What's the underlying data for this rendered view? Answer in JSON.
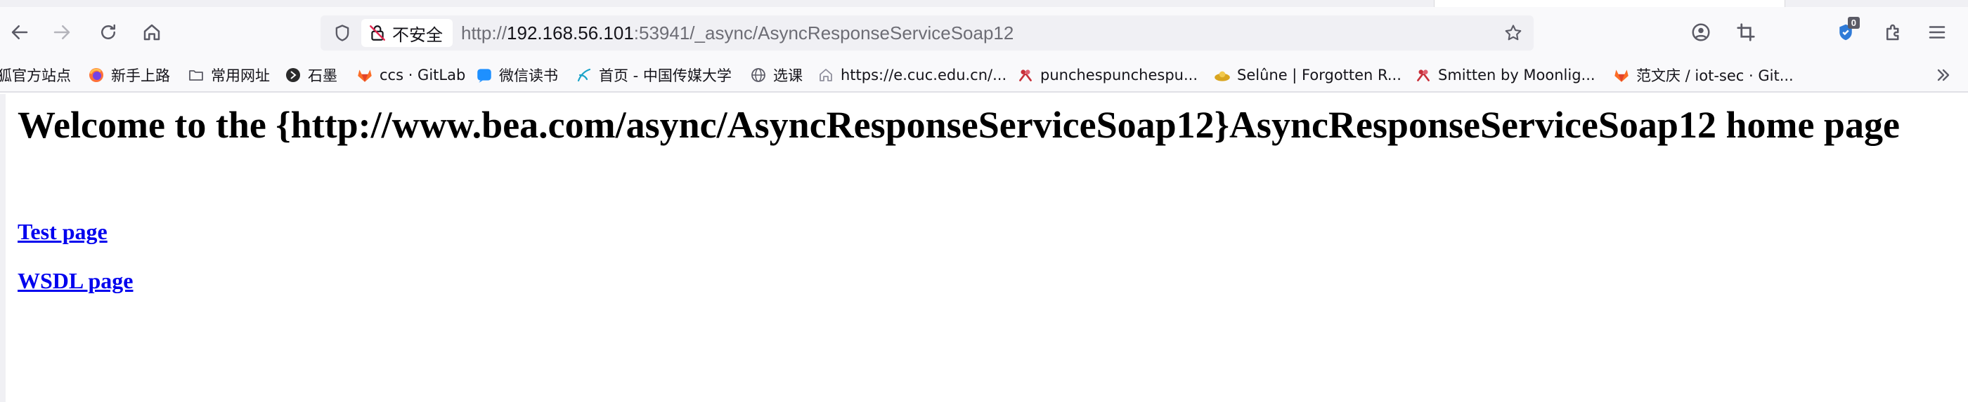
{
  "browser": {
    "url": {
      "prefix": "http://",
      "host": "192.168.56.101",
      "rest": ":53941/_async/AsyncResponseServiceSoap12"
    },
    "security_label": "不安全",
    "extension_badge": "0"
  },
  "bookmarks": [
    {
      "label": "狐官方站点",
      "icon": "folder-icon"
    },
    {
      "label": "新手上路",
      "icon": "firefox-icon"
    },
    {
      "label": "常用网址",
      "icon": "folder-icon"
    },
    {
      "label": "石墨",
      "icon": "shimo-icon"
    },
    {
      "label": "ccs · GitLab",
      "icon": "gitlab-icon"
    },
    {
      "label": "微信读书",
      "icon": "weread-icon"
    },
    {
      "label": "首页 - 中国传媒大学",
      "icon": "cuc-icon"
    },
    {
      "label": "选课",
      "icon": "globe-icon"
    },
    {
      "label": "https://e.cuc.edu.cn/...",
      "icon": "home-icon"
    },
    {
      "label": "punchespunchespu...",
      "icon": "punches-icon"
    },
    {
      "label": "Selûne | Forgotten R...",
      "icon": "selune-icon"
    },
    {
      "label": "Smitten by Moonlig...",
      "icon": "smitten-icon"
    },
    {
      "label": "范文庆 / iot-sec · Git...",
      "icon": "gitlab-icon"
    }
  ],
  "page": {
    "heading": "Welcome to the {http://www.bea.com/async/AsyncResponseServiceSoap12}AsyncResponseServiceSoap12 home page",
    "links": [
      {
        "label": "Test page"
      },
      {
        "label": "WSDL page"
      }
    ]
  }
}
